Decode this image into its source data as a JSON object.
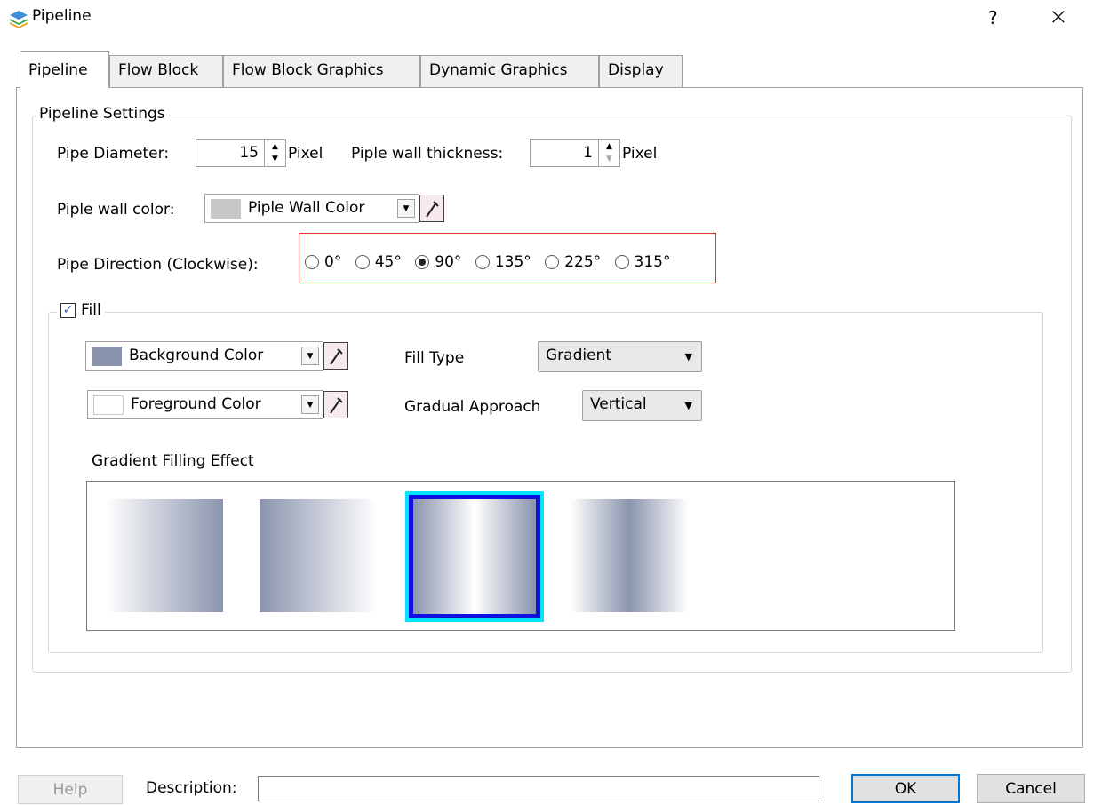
{
  "window": {
    "title": "Pipeline",
    "help_glyph": "?",
    "close_glyph": "×",
    "app_icon": "layers-icon"
  },
  "tabs": [
    {
      "label": "Pipeline",
      "active": true
    },
    {
      "label": "Flow Block",
      "active": false
    },
    {
      "label": "Flow Block Graphics",
      "active": false
    },
    {
      "label": "Dynamic Graphics",
      "active": false
    },
    {
      "label": "Display",
      "active": false
    }
  ],
  "pipeline_settings": {
    "title": "Pipeline Settings",
    "pipe_diameter_label": "Pipe Diameter:",
    "pipe_diameter_value": "15",
    "pipe_diameter_unit": "Pixel",
    "wall_thickness_label": "Piple wall thickness:",
    "wall_thickness_value": "1",
    "wall_thickness_unit": "Pixel",
    "wall_color_label": "Piple wall color:",
    "wall_color_text": "Piple Wall Color",
    "wall_color_hex": "#c8c8c8",
    "direction_label": "Pipe Direction (Clockwise):",
    "direction_options": [
      "0°",
      "45°",
      "90°",
      "135°",
      "225°",
      "315°"
    ],
    "direction_selected": "90°"
  },
  "fill": {
    "label": "Fill",
    "checked": true,
    "background_color_text": "Background Color",
    "background_color_hex": "#8a94ad",
    "foreground_color_text": "Foreground Color",
    "foreground_color_hex": "#ffffff",
    "fill_type_label": "Fill Type",
    "fill_type_value": "Gradient",
    "gradual_approach_label": "Gradual Approach",
    "gradual_approach_value": "Vertical",
    "gradient_effect_label": "Gradient Filling Effect",
    "gradient_selected_index": 2,
    "selection_outer_color": "#00e5ff",
    "selection_inner_color": "#1010e0"
  },
  "footer": {
    "help_label": "Help",
    "description_label": "Description:",
    "description_value": "",
    "ok_label": "OK",
    "cancel_label": "Cancel"
  }
}
